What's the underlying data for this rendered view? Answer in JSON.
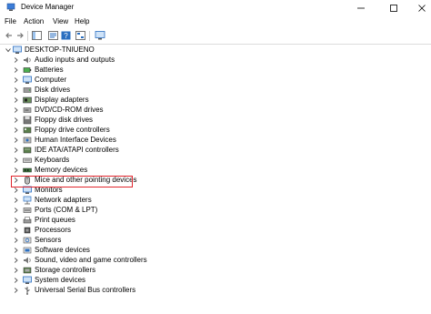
{
  "window": {
    "title": "Device Manager",
    "controls": {
      "minimize": "minimize-icon",
      "maximize": "maximize-icon",
      "close": "close-icon"
    }
  },
  "menu": [
    "File",
    "Action",
    "View",
    "Help"
  ],
  "toolbar": {
    "buttons": [
      "back-arrow-icon",
      "forward-arrow-icon",
      "show-hide-console-tree-icon",
      "properties-icon",
      "help-icon",
      "device-tree-view-icon",
      "scan-hardware-icon",
      "monitor-icon"
    ]
  },
  "tree": {
    "root": "DESKTOP-TNIUENO",
    "devices": [
      {
        "label": "Audio inputs and outputs",
        "icon": "speaker-icon"
      },
      {
        "label": "Batteries",
        "icon": "battery-icon"
      },
      {
        "label": "Computer",
        "icon": "computer-icon"
      },
      {
        "label": "Disk drives",
        "icon": "disk-drive-icon"
      },
      {
        "label": "Display adapters",
        "icon": "display-adapter-icon"
      },
      {
        "label": "DVD/CD-ROM drives",
        "icon": "dvd-drive-icon"
      },
      {
        "label": "Floppy disk drives",
        "icon": "floppy-disk-icon"
      },
      {
        "label": "Floppy drive controllers",
        "icon": "floppy-controller-icon"
      },
      {
        "label": "Human Interface Devices",
        "icon": "hid-icon"
      },
      {
        "label": "IDE ATA/ATAPI controllers",
        "icon": "ide-controller-icon"
      },
      {
        "label": "Keyboards",
        "icon": "keyboard-icon"
      },
      {
        "label": "Memory devices",
        "icon": "memory-icon"
      },
      {
        "label": "Mice and other pointing devices",
        "icon": "mouse-icon",
        "highlighted": true
      },
      {
        "label": "Monitors",
        "icon": "monitor-icon"
      },
      {
        "label": "Network adapters",
        "icon": "network-adapter-icon"
      },
      {
        "label": "Ports (COM & LPT)",
        "icon": "port-icon"
      },
      {
        "label": "Print queues",
        "icon": "printer-icon"
      },
      {
        "label": "Processors",
        "icon": "processor-icon"
      },
      {
        "label": "Sensors",
        "icon": "sensor-icon"
      },
      {
        "label": "Software devices",
        "icon": "software-device-icon"
      },
      {
        "label": "Sound, video and game controllers",
        "icon": "sound-controller-icon"
      },
      {
        "label": "Storage controllers",
        "icon": "storage-controller-icon"
      },
      {
        "label": "System devices",
        "icon": "system-device-icon"
      },
      {
        "label": "Universal Serial Bus controllers",
        "icon": "usb-icon"
      }
    ]
  },
  "colors": {
    "highlight": "#e0242c",
    "icon_blue": "#2b6fc0",
    "icon_gray": "#6b6b6b"
  }
}
